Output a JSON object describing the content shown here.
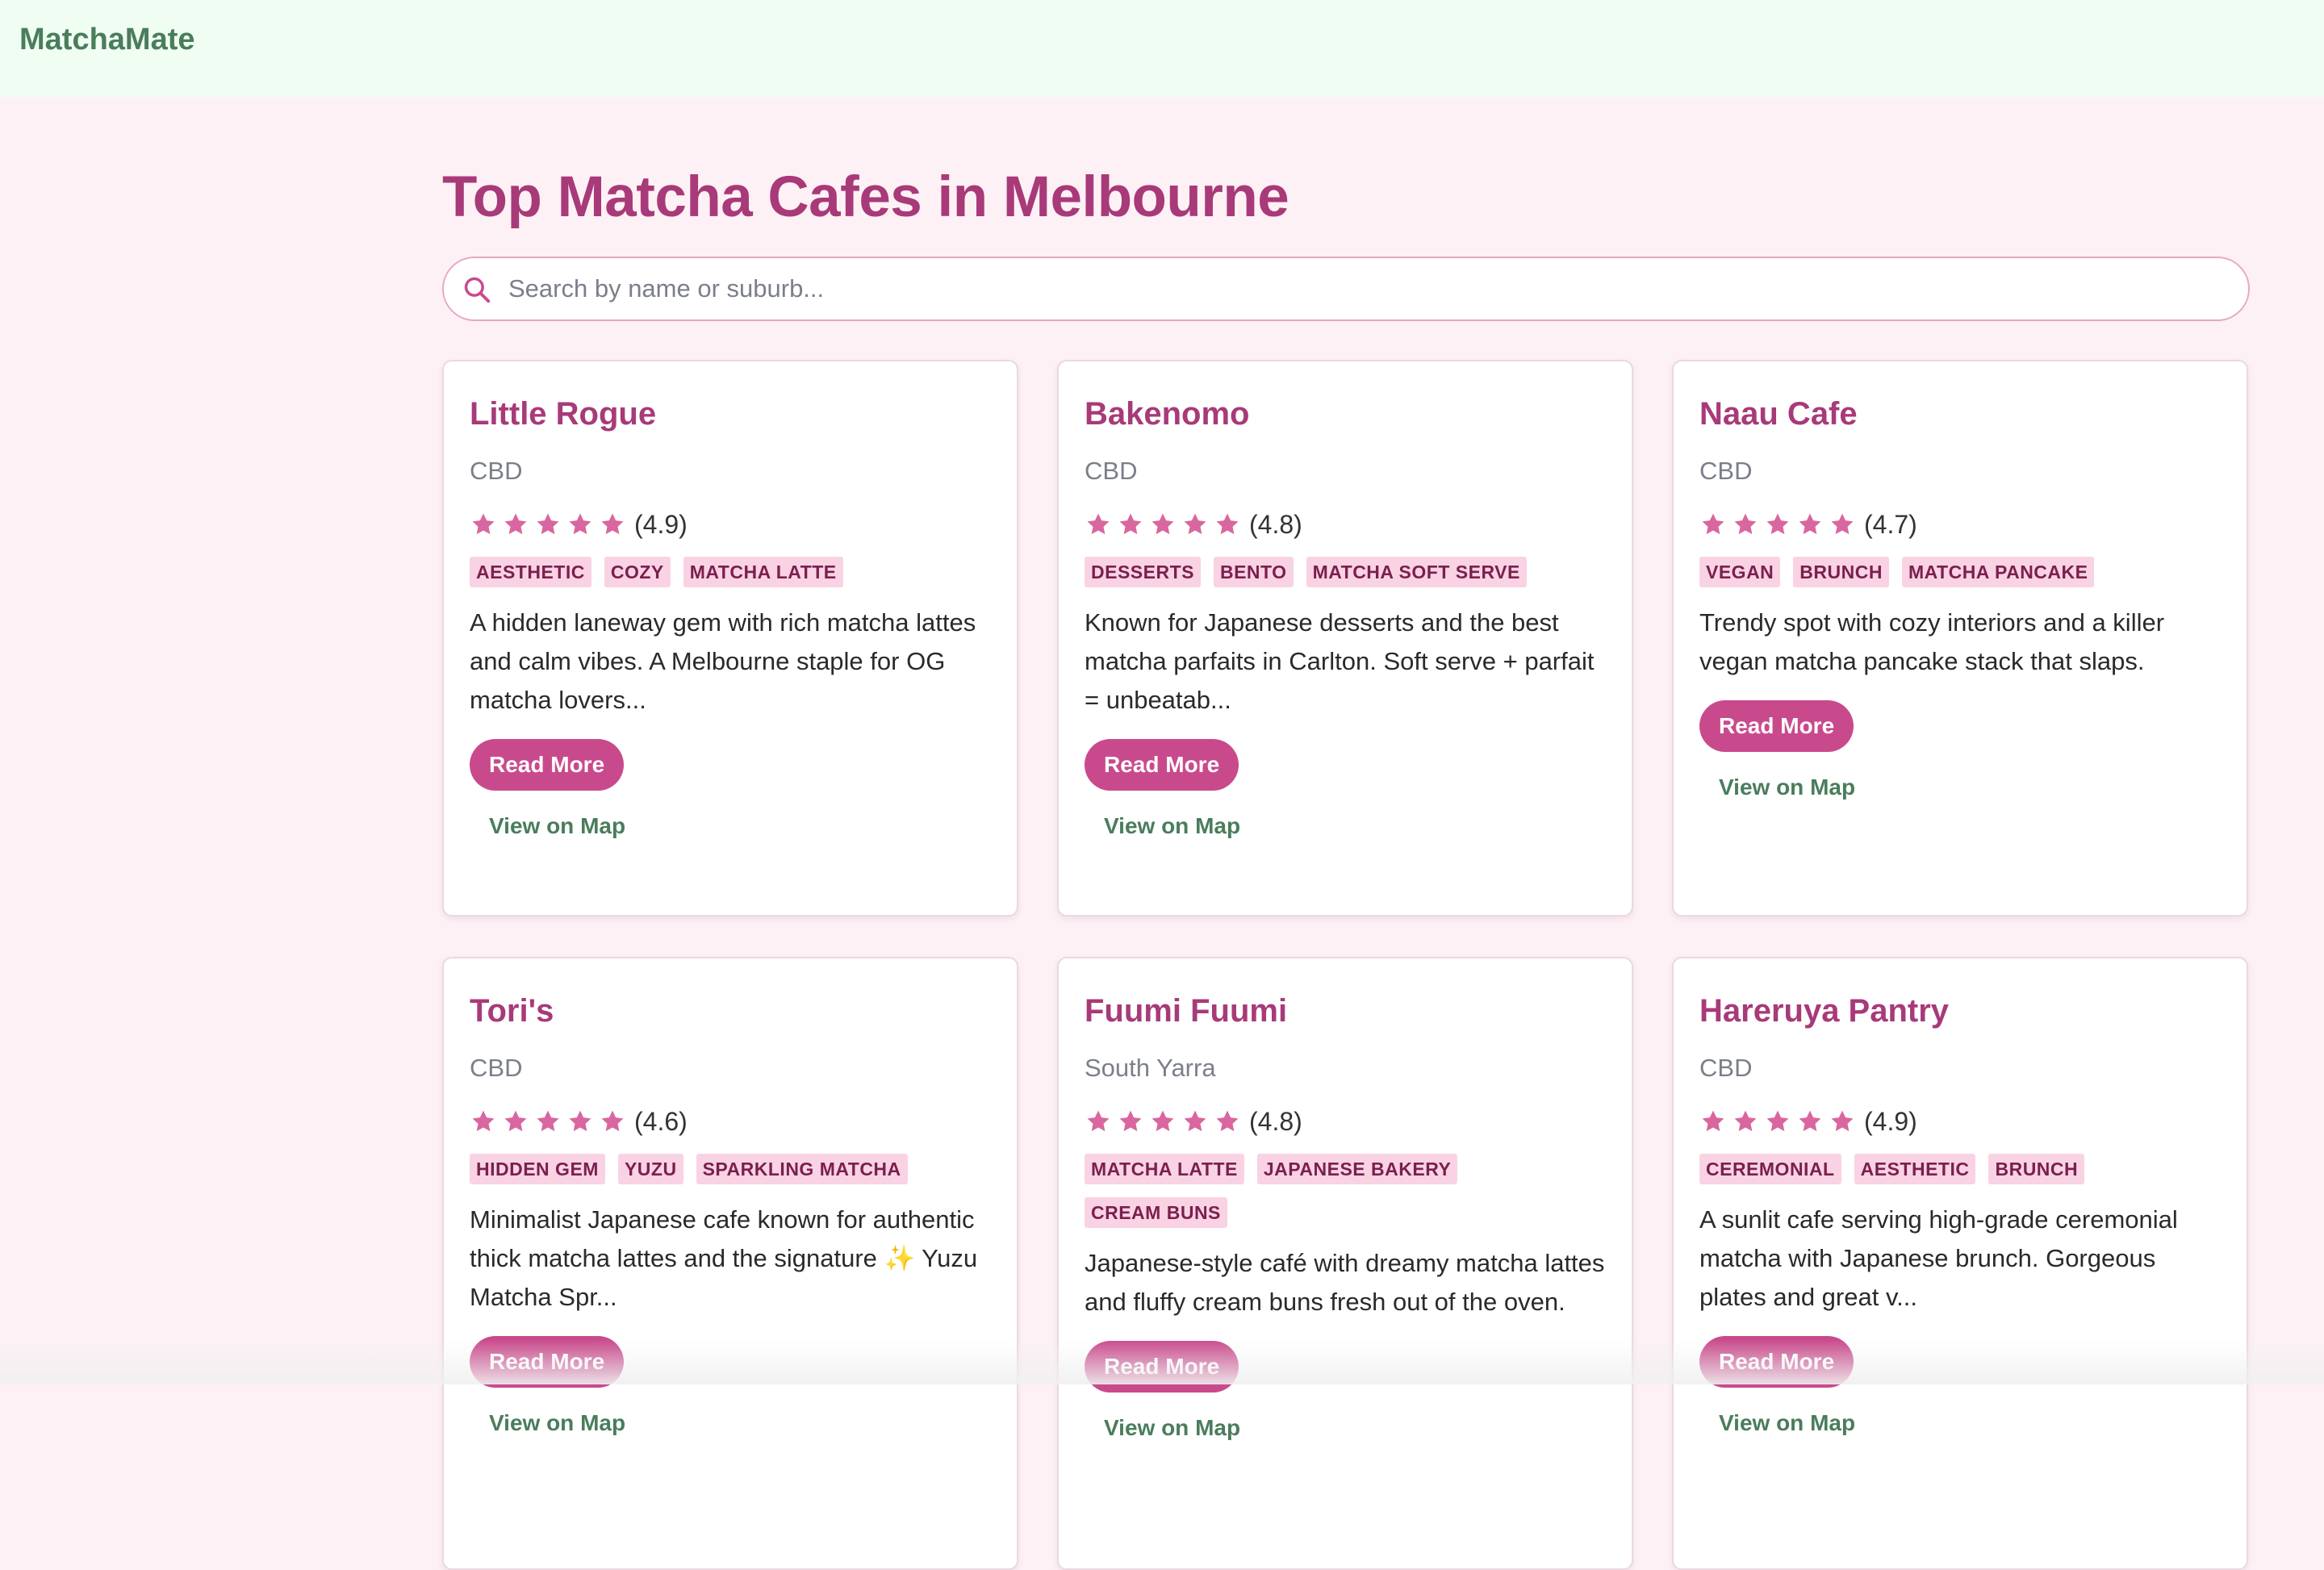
{
  "app": {
    "brand": "MatchaMate"
  },
  "page": {
    "title": "Top Matcha Cafes in Melbourne"
  },
  "search": {
    "placeholder": "Search by name or suburb...",
    "value": ""
  },
  "colors": {
    "accent": "#c94a8c",
    "title": "#a83a79",
    "brand": "#4a7d5b",
    "star": "#d9669f",
    "tag_bg": "#f9d3e3"
  },
  "cards": [
    {
      "name": "Little Rogue",
      "suburb": "CBD",
      "rating": 4.9,
      "rating_text": "(4.9)",
      "stars": 5,
      "tags": [
        "AESTHETIC",
        "COZY",
        "MATCHA LATTE"
      ],
      "description": "A hidden laneway gem with rich matcha lattes and calm vibes. A Melbourne staple for OG matcha lovers...",
      "read_more": "Read More",
      "map": "View on Map"
    },
    {
      "name": "Bakenomo",
      "suburb": "CBD",
      "rating": 4.8,
      "rating_text": "(4.8)",
      "stars": 5,
      "tags": [
        "DESSERTS",
        "BENTO",
        "MATCHA SOFT SERVE"
      ],
      "description": "Known for Japanese desserts and the best matcha parfaits in Carlton. Soft serve + parfait = unbeatab...",
      "read_more": "Read More",
      "map": "View on Map"
    },
    {
      "name": "Naau Cafe",
      "suburb": "CBD",
      "rating": 4.7,
      "rating_text": "(4.7)",
      "stars": 5,
      "tags": [
        "VEGAN",
        "BRUNCH",
        "MATCHA PANCAKE"
      ],
      "description": "Trendy spot with cozy interiors and a killer vegan matcha pancake stack that slaps.",
      "read_more": "Read More",
      "map": "View on Map"
    },
    {
      "name": "Tori's",
      "suburb": "CBD",
      "rating": 4.6,
      "rating_text": "(4.6)",
      "stars": 5,
      "tags": [
        "HIDDEN GEM",
        "YUZU",
        "SPARKLING MATCHA"
      ],
      "description": "Minimalist Japanese cafe known for authentic thick matcha lattes and the signature ✨ Yuzu Matcha Spr...",
      "read_more": "Read More",
      "map": "View on Map"
    },
    {
      "name": "Fuumi Fuumi",
      "suburb": "South Yarra",
      "rating": 4.8,
      "rating_text": "(4.8)",
      "stars": 5,
      "tags": [
        "MATCHA LATTE",
        "JAPANESE BAKERY",
        "CREAM BUNS"
      ],
      "description": "Japanese-style café with dreamy matcha lattes and fluffy cream buns fresh out of the oven.",
      "read_more": "Read More",
      "map": "View on Map"
    },
    {
      "name": "Hareruya Pantry",
      "suburb": "CBD",
      "rating": 4.9,
      "rating_text": "(4.9)",
      "stars": 5,
      "tags": [
        "CEREMONIAL",
        "AESTHETIC",
        "BRUNCH"
      ],
      "description": "A sunlit cafe serving high-grade ceremonial matcha with Japanese brunch. Gorgeous plates and great v...",
      "read_more": "Read More",
      "map": "View on Map"
    }
  ]
}
